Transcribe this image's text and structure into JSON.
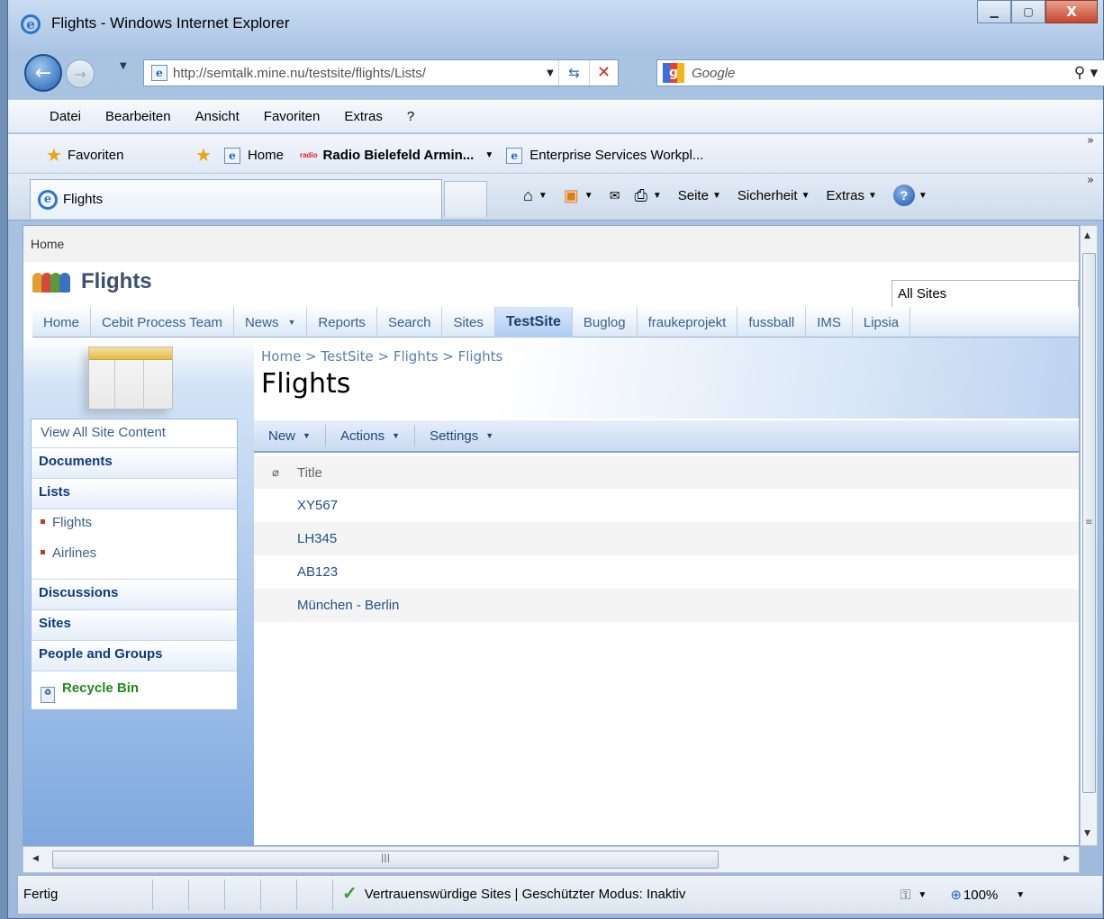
{
  "window": {
    "title": "Flights - Windows Internet Explorer"
  },
  "address": {
    "url": "http://semtalk.mine.nu/testsite/flights/Lists/",
    "search_placeholder": "Google"
  },
  "menubar": [
    "Datei",
    "Bearbeiten",
    "Ansicht",
    "Favoriten",
    "Extras",
    "?"
  ],
  "favbar": {
    "favorites_label": "Favoriten",
    "items": [
      "Home",
      "Radio Bielefeld Armin...",
      "Enterprise Services Workpl..."
    ],
    "radio_logo": "radio"
  },
  "tabbar": {
    "tab_title": "Flights"
  },
  "commands": {
    "page": "Seite",
    "security": "Sicherheit",
    "extras": "Extras"
  },
  "status": {
    "text": "Fertig",
    "trust": "Vertrauenswürdige Sites | Geschützter Modus: Inaktiv",
    "zoom": "100%"
  },
  "sp": {
    "top_breadcrumb": "Home",
    "site_title": "Flights",
    "scope": "All Sites",
    "tabs": [
      "Home",
      "Cebit Process Team",
      "News",
      "Reports",
      "Search",
      "Sites",
      "TestSite",
      "Buglog",
      "fraukeprojekt",
      "fussball",
      "IMS",
      "Lipsia"
    ],
    "selected_tab": "TestSite",
    "news_dropdown": "▾",
    "breadcrumb": "Home > TestSite > Flights > Flights",
    "page_title": "Flights",
    "quicklaunch": {
      "view_all": "View All Site Content",
      "documents": "Documents",
      "lists": "Lists",
      "list_items": [
        "Flights",
        "Airlines"
      ],
      "discussions": "Discussions",
      "sites": "Sites",
      "people": "People and Groups",
      "recycle": "Recycle Bin"
    },
    "toolbar": {
      "new": "New",
      "actions": "Actions",
      "settings": "Settings"
    },
    "column_title": "Title",
    "rows": [
      "XY567",
      "LH345",
      "AB123",
      "München - Berlin"
    ]
  },
  "colors": {
    "accent": "#3b5f8f",
    "selected_tab": "#aecbf0",
    "recycle": "#1f8a1f"
  }
}
